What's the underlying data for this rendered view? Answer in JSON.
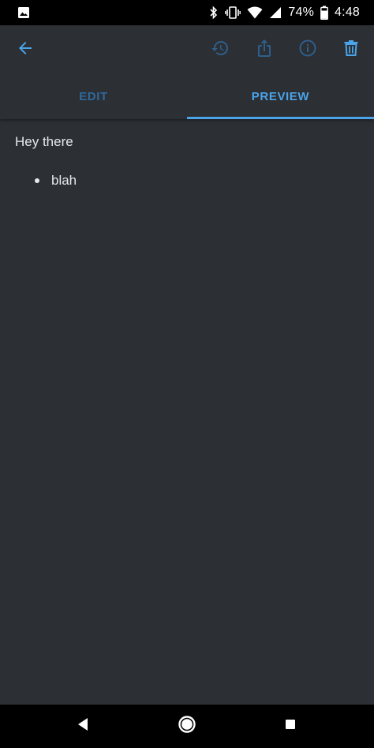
{
  "status_bar": {
    "battery": "74%",
    "time": "4:48",
    "icons": [
      "image-icon",
      "bluetooth-icon",
      "vibrate-icon",
      "wifi-icon",
      "signal-icon",
      "battery-icon"
    ]
  },
  "app_bar": {
    "icons": [
      "back-arrow-icon",
      "history-icon",
      "share-icon",
      "info-icon",
      "delete-icon"
    ]
  },
  "tabs": [
    {
      "label": "EDIT",
      "active": false
    },
    {
      "label": "PREVIEW",
      "active": true
    }
  ],
  "content": {
    "paragraph": "Hey there",
    "bullets": [
      "blah"
    ]
  },
  "nav_bar": {
    "icons": [
      "nav-back-icon",
      "nav-home-icon",
      "nav-recents-icon"
    ]
  },
  "colors": {
    "background": "#2c2f34",
    "accent": "#4ba3e8",
    "accent_dim": "#2e6a9e",
    "text": "#e6e8ea"
  }
}
